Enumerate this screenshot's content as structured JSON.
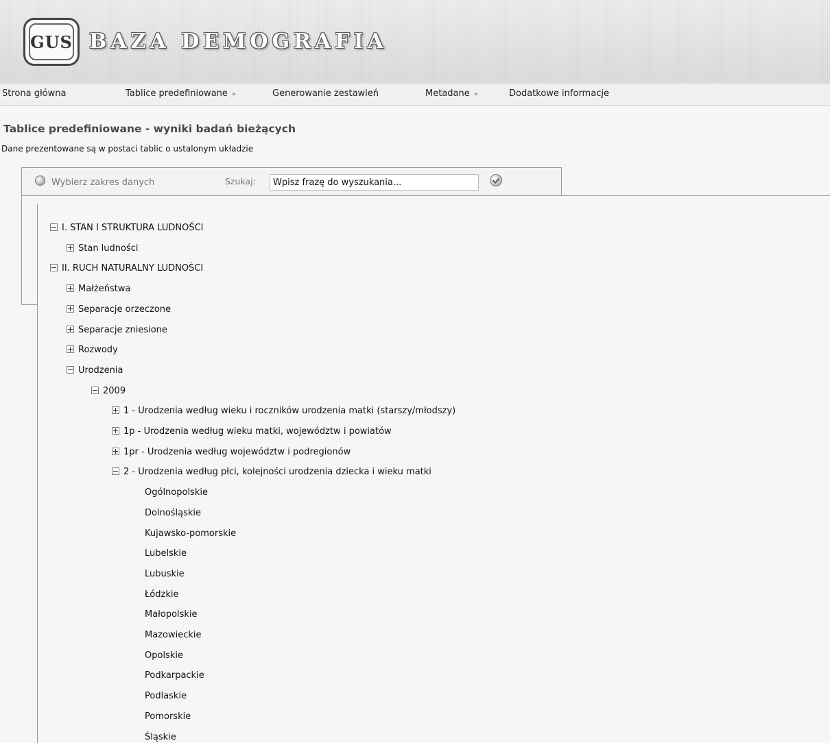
{
  "header": {
    "logo_text": "GUS",
    "app_title": "BAZA DEMOGRAFIA"
  },
  "nav": {
    "items": [
      {
        "label": "Strona główna",
        "has_dropdown": false
      },
      {
        "label": "Tablice predefiniowane",
        "has_dropdown": true
      },
      {
        "label": "Generowanie zestawień",
        "has_dropdown": false
      },
      {
        "label": "Metadane",
        "has_dropdown": true
      },
      {
        "label": "Dodatkowe informacje",
        "has_dropdown": false
      }
    ],
    "dropdown_glyph": "»"
  },
  "page": {
    "title": "Tablice predefiniowane - wyniki badań bieżących",
    "description": "Dane prezentowane są w postaci tablic o ustalonym układzie"
  },
  "filter": {
    "scope_label": "Wybierz zakres danych",
    "search_label": "Szukaj:",
    "search_value": "Wpisz frazę do wyszukania..."
  },
  "tree": [
    {
      "label": "I. STAN I STRUKTURA LUDNOŚCI",
      "expanded": true,
      "level": 0
    },
    {
      "label": "Stan ludności",
      "expanded": false,
      "level": 1
    },
    {
      "label": "II. RUCH NATURALNY LUDNOŚCI",
      "expanded": true,
      "level": 0
    },
    {
      "label": "Małżeństwa",
      "expanded": false,
      "level": 1
    },
    {
      "label": "Separacje orzeczone",
      "expanded": false,
      "level": 1
    },
    {
      "label": "Separacje zniesione",
      "expanded": false,
      "level": 1
    },
    {
      "label": "Rozwody",
      "expanded": false,
      "level": 1
    },
    {
      "label": "Urodzenia",
      "expanded": true,
      "level": 1
    },
    {
      "label": "2009",
      "expanded": true,
      "level": 2
    },
    {
      "label": "1 - Urodzenia według wieku i roczników urodzenia matki (starszy/młodszy)",
      "expanded": false,
      "level": 3
    },
    {
      "label": "1p - Urodzenia według wieku matki, województw i powiatów",
      "expanded": false,
      "level": 3
    },
    {
      "label": "1pr - Urodzenia według województw i podregionów",
      "expanded": false,
      "level": 3
    },
    {
      "label": "2 - Urodzenia według płci, kolejności urodzenia dziecka i wieku matki",
      "expanded": true,
      "level": 3
    },
    {
      "label": "Ogólnopolskie",
      "leaf": true,
      "level": 4
    },
    {
      "label": "Dolnośląskie",
      "leaf": true,
      "level": 4
    },
    {
      "label": "Kujawsko-pomorskie",
      "leaf": true,
      "level": 4
    },
    {
      "label": "Lubelskie",
      "leaf": true,
      "level": 4
    },
    {
      "label": "Lubuskie",
      "leaf": true,
      "level": 4
    },
    {
      "label": "Łódzkie",
      "leaf": true,
      "level": 4
    },
    {
      "label": "Małopolskie",
      "leaf": true,
      "level": 4
    },
    {
      "label": "Mazowieckie",
      "leaf": true,
      "level": 4
    },
    {
      "label": "Opolskie",
      "leaf": true,
      "level": 4
    },
    {
      "label": "Podkarpackie",
      "leaf": true,
      "level": 4
    },
    {
      "label": "Podlaskie",
      "leaf": true,
      "level": 4
    },
    {
      "label": "Pomorskie",
      "leaf": true,
      "level": 4
    },
    {
      "label": "Śląskie",
      "leaf": true,
      "level": 4
    }
  ]
}
